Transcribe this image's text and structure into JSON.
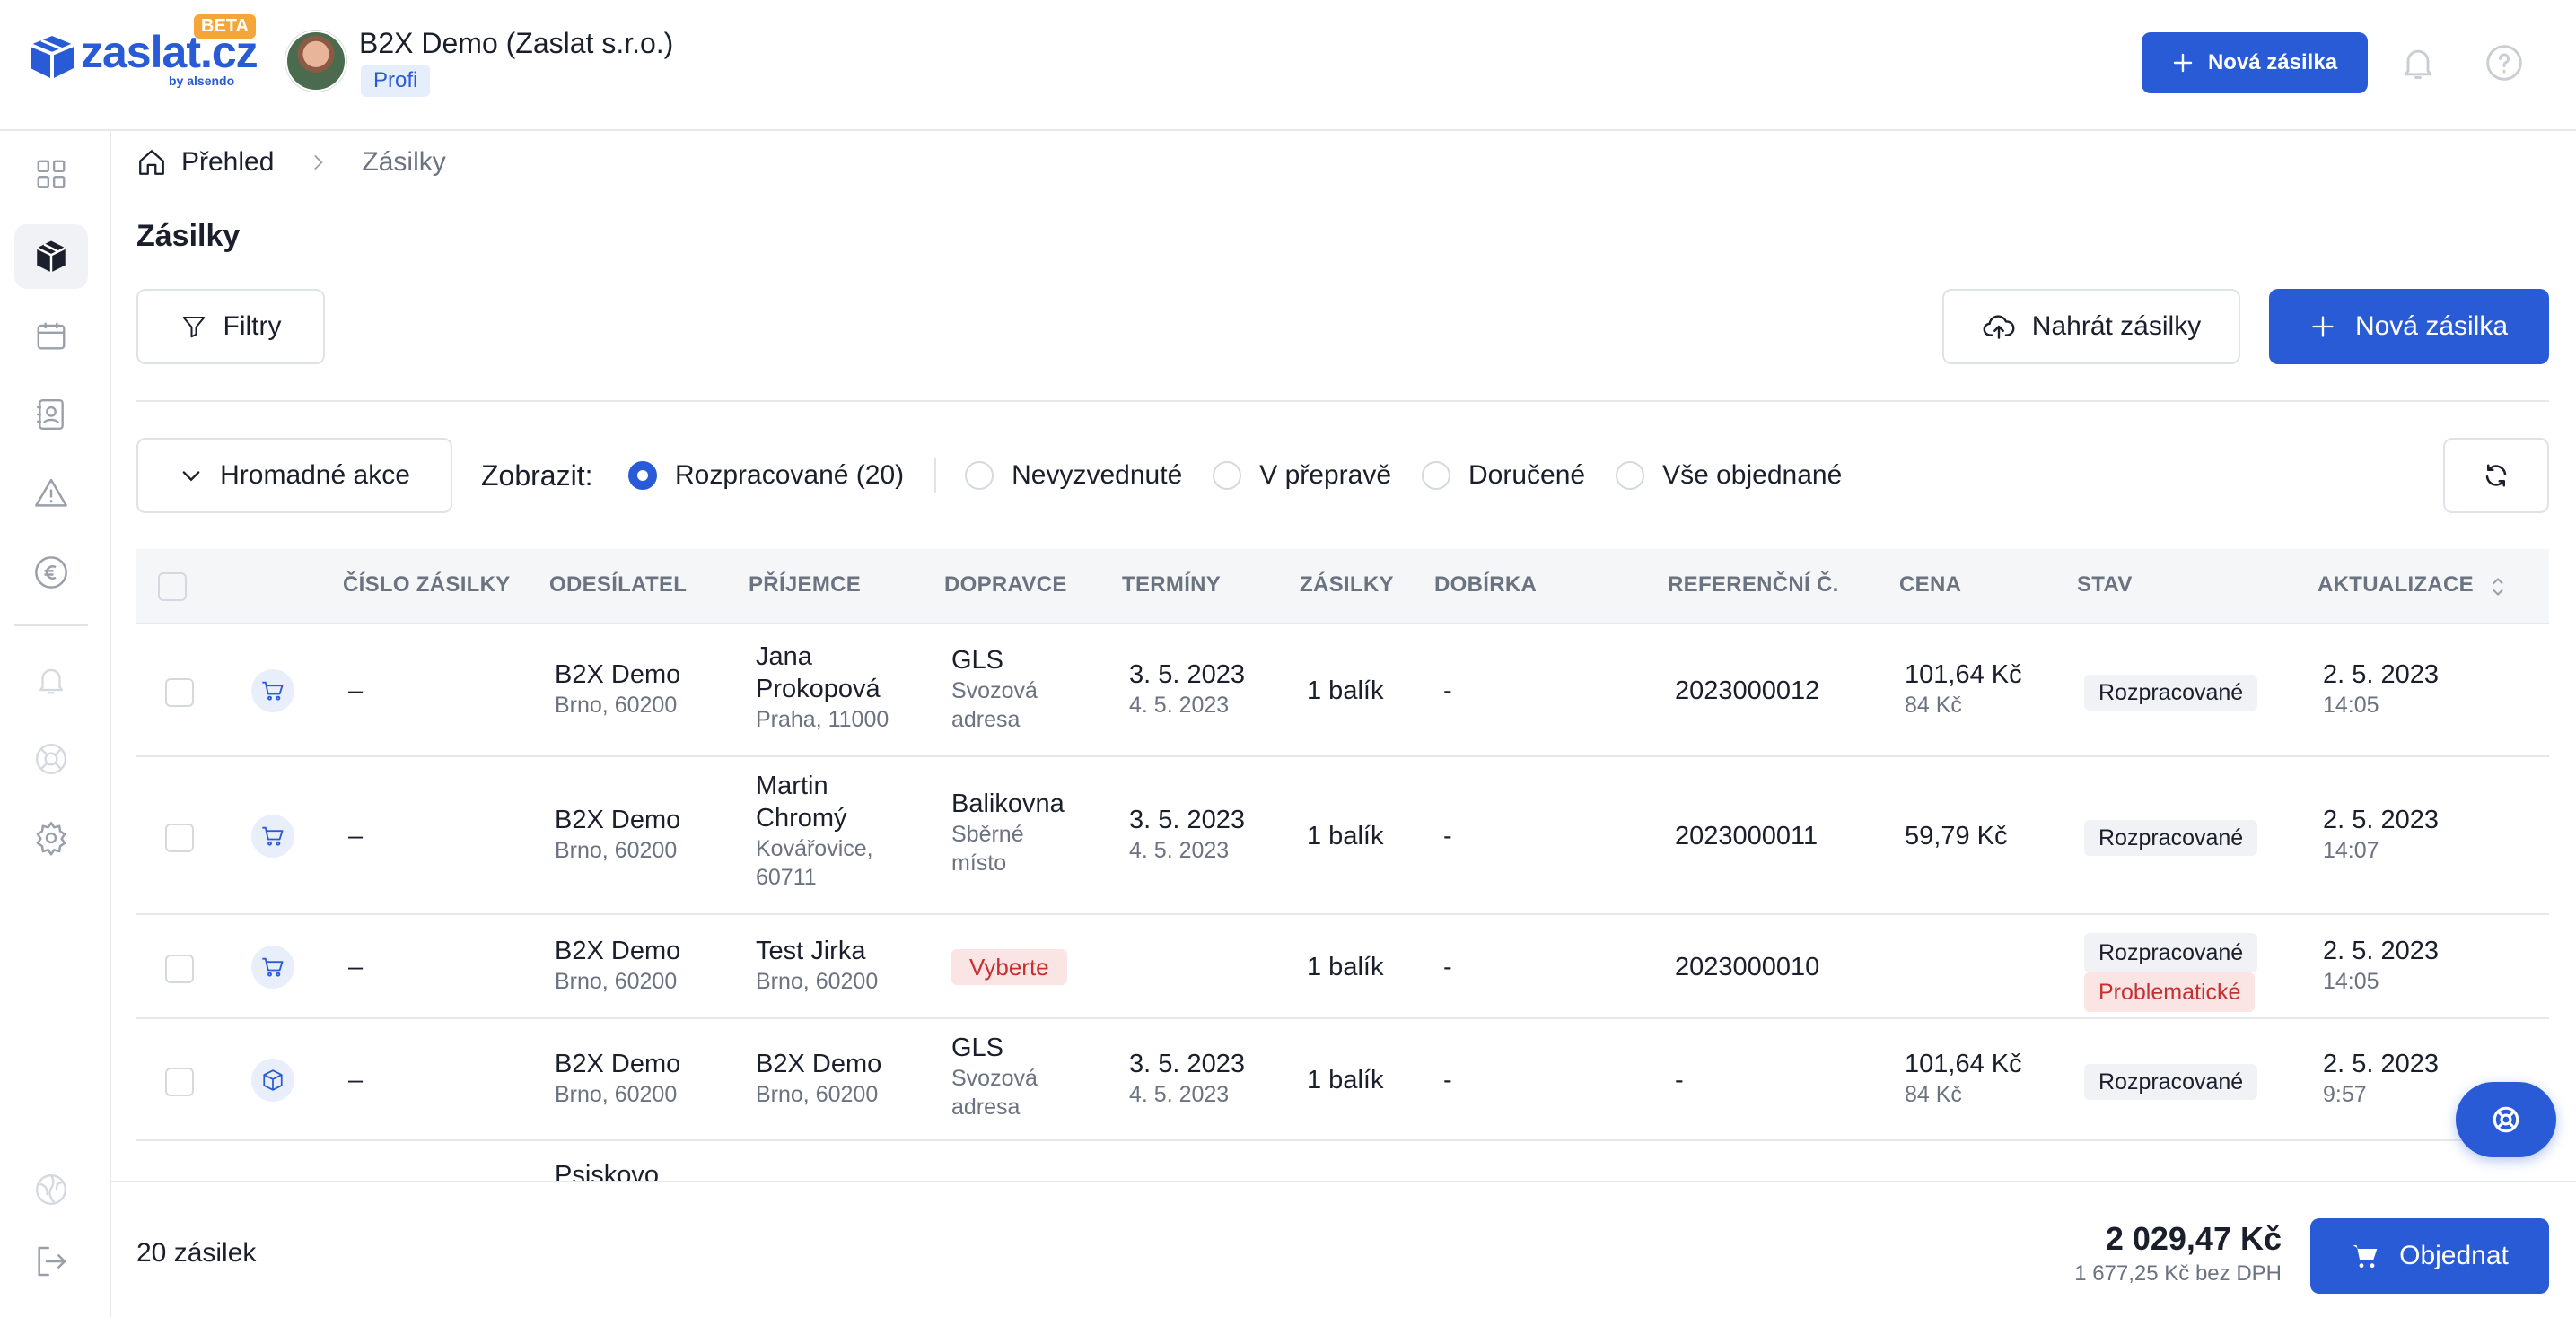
{
  "brand": {
    "name": "zaslat.cz",
    "by": "by alsendo",
    "beta": "BETA",
    "color": "#2a5bd7"
  },
  "header": {
    "company": "B2X Demo (Zaslat s.r.o.)",
    "plan": "Profi",
    "new_label": "Nová zásilka"
  },
  "sidebar": {
    "items": [
      "dashboard-icon",
      "box-icon",
      "calendar-icon",
      "contacts-icon",
      "warning-icon",
      "euro-icon",
      "bell-icon",
      "support-icon",
      "settings-icon",
      "globe-icon",
      "logout-icon"
    ]
  },
  "breadcrumb": {
    "home": "Přehled",
    "current": "Zásilky"
  },
  "page": {
    "title": "Zásilky",
    "filters": "Filtry",
    "upload": "Nahrát zásilky",
    "new": "Nová zásilka",
    "bulk": "Hromadné akce",
    "show": "Zobrazit:",
    "tabs": [
      {
        "label": "Rozpracované (20)",
        "selected": true
      },
      {
        "label": "Nevyzvednuté",
        "selected": false
      },
      {
        "label": "V přepravě",
        "selected": false
      },
      {
        "label": "Doručené",
        "selected": false
      },
      {
        "label": "Vše objednané",
        "selected": false
      }
    ]
  },
  "table": {
    "headers": [
      "ČÍSLO ZÁSILKY",
      "ODESÍLATEL",
      "PŘÍJEMCE",
      "DOPRAVCE",
      "TERMÍNY",
      "ZÁSILKY",
      "DOBÍRKA",
      "REFERENČNÍ Č.",
      "CENA",
      "STAV",
      "AKTUALIZACE"
    ],
    "rows": [
      {
        "number": "–",
        "sender": "B2X Demo",
        "sender_addr": "Brno, 60200",
        "recipient": "Jana Prokopová",
        "recipient_addr": "Praha, 11000",
        "carrier": "GLS",
        "carrier_sub": "Svozová adresa",
        "date1": "3. 5. 2023",
        "date2": "4. 5. 2023",
        "packages": "1 balík",
        "cod": "-",
        "ref": "2023000012",
        "price": "101,64 Kč",
        "price_sub": "84 Kč",
        "status": [
          "Rozpracované"
        ],
        "updated": "2. 5. 2023",
        "updated_time": "14:05"
      },
      {
        "number": "–",
        "sender": "B2X Demo",
        "sender_addr": "Brno, 60200",
        "recipient": "Martin Chromý",
        "recipient_addr": "Kovářovice, 60711",
        "carrier": "Balikovna",
        "carrier_sub": "Sběrné místo",
        "date1": "3. 5. 2023",
        "date2": "4. 5. 2023",
        "packages": "1 balík",
        "cod": "-",
        "ref": "2023000011",
        "price": "59,79 Kč",
        "price_sub": "",
        "status": [
          "Rozpracované"
        ],
        "updated": "2. 5. 2023",
        "updated_time": "14:07"
      },
      {
        "number": "–",
        "sender": "B2X Demo",
        "sender_addr": "Brno, 60200",
        "recipient": "Test Jirka",
        "recipient_addr": "Brno, 60200",
        "carrier": "Vyberte",
        "packages": "1 balík",
        "cod": "-",
        "ref": "2023000010",
        "status": [
          "Rozpracované",
          "Problematické"
        ],
        "updated": "2. 5. 2023",
        "updated_time": "14:05"
      },
      {
        "number": "–",
        "sender": "B2X Demo",
        "sender_addr": "Brno, 60200",
        "recipient": "B2X Demo",
        "recipient_addr": "Brno, 60200",
        "carrier": "GLS",
        "carrier_sub": "Svozová adresa",
        "date1": "3. 5. 2023",
        "date2": "4. 5. 2023",
        "packages": "1 balík",
        "cod": "-",
        "ref": "-",
        "price": "101,64 Kč",
        "price_sub": "84 Kč",
        "status": [
          "Rozpracované"
        ],
        "updated": "2. 5. 2023",
        "updated_time": "9:57"
      }
    ],
    "partial_row": "Psiskovo"
  },
  "footer": {
    "count": "20 zásilek",
    "total": "2 029,47 Kč",
    "total_net": "1 677,25 Kč bez DPH",
    "order": "Objednat"
  }
}
